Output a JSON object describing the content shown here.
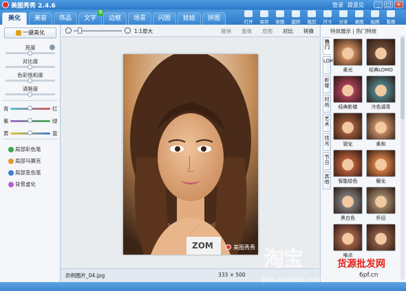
{
  "window": {
    "title": "美图秀秀 2.4.6",
    "links": [
      "登录",
      "提意见"
    ],
    "controls": [
      "_",
      "□",
      "×"
    ]
  },
  "tabs": [
    {
      "label": "美化",
      "active": true
    },
    {
      "label": "美容"
    },
    {
      "label": "饰品"
    },
    {
      "label": "文字",
      "badge": "新"
    },
    {
      "label": "边框"
    },
    {
      "label": "场景"
    },
    {
      "label": "闪图"
    },
    {
      "label": "娃娃"
    },
    {
      "label": "拼图"
    }
  ],
  "tools": [
    "打开",
    "保存",
    "抠图",
    "旋转",
    "裁剪",
    "尺寸",
    "分享",
    "录图",
    "拍照",
    "看图"
  ],
  "left_panel": {
    "one_click": "一键美化",
    "sliders": [
      {
        "label": "亮度",
        "value": 0.5
      },
      {
        "label": "对比度",
        "value": 0.5
      },
      {
        "label": "色彩饱和度",
        "value": 0.5
      },
      {
        "label": "清晰度",
        "value": 0.5
      }
    ],
    "color_sliders": [
      {
        "left": "青",
        "right": "红",
        "value": 0.5,
        "color": "#d9534f"
      },
      {
        "left": "紫",
        "right": "绿",
        "value": 0.5,
        "color": "#4caf50"
      },
      {
        "left": "黄",
        "right": "蓝",
        "value": 0.5,
        "color": "#3d7fd4"
      }
    ],
    "features": [
      "局部彩色笔",
      "局部马赛克",
      "局部变色笔",
      "背景虚化"
    ]
  },
  "editor": {
    "zoom_label": "1:1原大",
    "buttons": [
      "撤销",
      "重做",
      "原图",
      "对比",
      "转换"
    ],
    "filename": "示例图片_04.jpg",
    "dimensions": "333 × 500",
    "photo_watermark": "美图秀秀",
    "photo_shirt_text": "ZOM"
  },
  "right_panel": {
    "breadcrumb": "特效展示 | 热门特效",
    "vtabs": [
      "热门",
      "LOMO",
      "影楼",
      "时尚",
      "艺术",
      "炫光",
      "节日",
      "其他"
    ],
    "effects": [
      {
        "label": "柔光",
        "tone": "#c98a5e"
      },
      {
        "label": "经典LOMO",
        "tone": "#6b4a3a"
      },
      {
        "label": "经典影楼",
        "tone": "#a6405a"
      },
      {
        "label": "冷色调青",
        "tone": "#4d7f86"
      },
      {
        "label": "锐化",
        "tone": "#9a5a3a"
      },
      {
        "label": "柔和",
        "tone": "#c08a66"
      },
      {
        "label": "智能绘色",
        "tone": "#b35c3a"
      },
      {
        "label": "暖化",
        "tone": "#cf7a45"
      },
      {
        "label": "黑白色",
        "tone": "#7a7a7a"
      },
      {
        "label": "怀旧",
        "tone": "#9a8468"
      },
      {
        "label": "噪点",
        "tone": "#a0624a"
      },
      {
        "label": "",
        "tone": "#8a5a46"
      }
    ]
  },
  "overlay": {
    "taobao": "淘宝",
    "shop": "货源批发网",
    "url": "bbs.taobao.com",
    "url2": "6pf.cn"
  }
}
